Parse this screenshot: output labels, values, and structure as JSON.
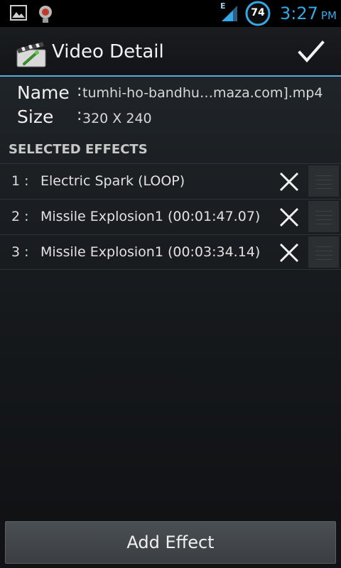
{
  "statusbar": {
    "network_type": "E",
    "battery_level": "74",
    "time": "3:27",
    "ampm": "PM",
    "icons": [
      "gallery-notification-icon",
      "app-notification-icon",
      "signal-icon",
      "battery-icon"
    ]
  },
  "actionbar": {
    "title": "Video Detail",
    "done_icon": "checkmark-icon"
  },
  "details": {
    "name_label": "Name",
    "name_value": "tumhi-ho-bandhu…maza.com].mp4",
    "size_label": "Size",
    "size_value": "320 X 240",
    "separator": ":"
  },
  "effects": {
    "header": "SELECTED EFFECTS",
    "items": [
      {
        "index": "1 :",
        "name": "Electric Spark (LOOP)"
      },
      {
        "index": "2 :",
        "name": "Missile Explosion1 (00:01:47.07)"
      },
      {
        "index": "3 :",
        "name": "Missile Explosion1 (00:03:34.14)"
      }
    ]
  },
  "footer": {
    "add_effect_label": "Add Effect"
  },
  "colors": {
    "accent": "#35a9e8",
    "divider": "#5aa9d8"
  }
}
